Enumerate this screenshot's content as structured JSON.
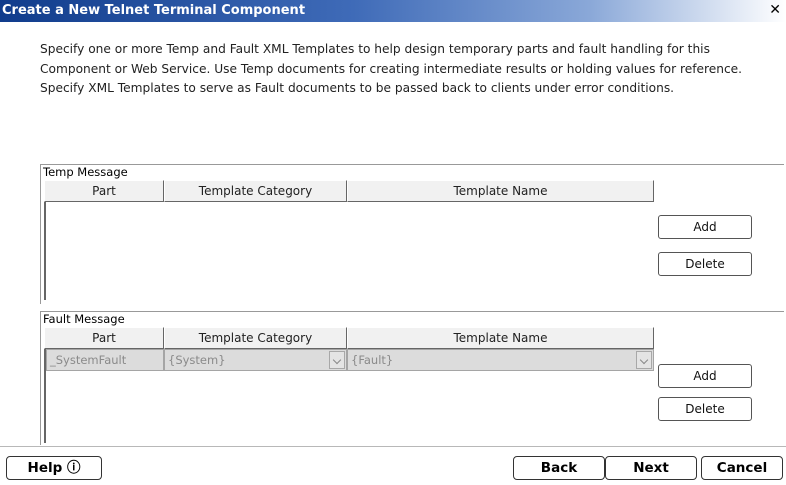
{
  "window": {
    "title": "Create a New Telnet Terminal Component",
    "close_label": "✕"
  },
  "intro": "Specify one or more Temp and Fault XML Templates to help design temporary parts and fault handling for this Component or Web Service.  Use Temp documents for creating intermediate results or holding values for reference. Specify XML Templates to serve as Fault documents to be passed back to clients under error conditions.",
  "temp": {
    "label": "Temp Message",
    "columns": [
      "Part",
      "Template Category",
      "Template Name"
    ],
    "add_label": "Add",
    "delete_label": "Delete"
  },
  "fault": {
    "label": "Fault Message",
    "columns": [
      "Part",
      "Template Category",
      "Template Name"
    ],
    "row": {
      "part": "_SystemFault",
      "category": "{System}",
      "name": "{Fault}"
    },
    "add_label": "Add",
    "delete_label": "Delete"
  },
  "footer": {
    "help_label": "Help ⓘ",
    "back_label": "Back",
    "next_label": "Next",
    "cancel_label": "Cancel"
  }
}
